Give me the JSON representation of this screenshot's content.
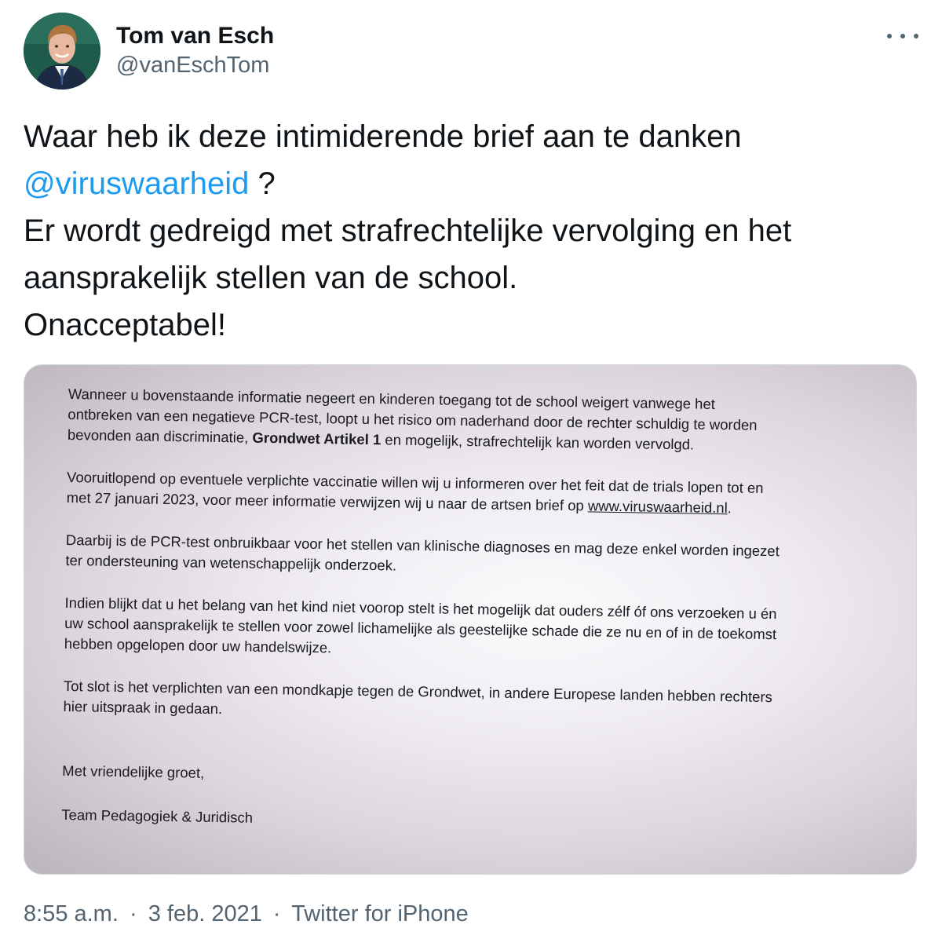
{
  "author": {
    "display_name": "Tom van Esch",
    "handle": "@vanEschTom",
    "avatar_icon": "profile-photo"
  },
  "tweet": {
    "line1": "Waar heb ik deze intimiderende brief aan te danken",
    "mention": "@viruswaarheid",
    "after_mention": " ?",
    "line3": "Er wordt gedreigd met strafrechtelijke vervolging en het",
    "line4": "aansprakelijk stellen van de school.",
    "line5": "Onacceptabel!"
  },
  "letter": {
    "p1_l1": "Wanneer u bovenstaande informatie negeert en kinderen toegang tot de school weigert vanwege het",
    "p1_l2": "ontbreken van een negatieve PCR-test, loopt u het risico om naderhand door de rechter schuldig te worden",
    "p1_l3_a": "bevonden aan discriminatie, ",
    "p1_l3_bold": "Grondwet Artikel 1",
    "p1_l3_b": " en mogelijk, strafrechtelijk kan worden vervolgd.",
    "p2_l1": "Vooruitlopend op eventuele verplichte vaccinatie willen wij u informeren over het feit dat de trials lopen tot en",
    "p2_l2_a": "met 27 januari 2023, voor meer informatie verwijzen wij u naar de artsen brief op ",
    "p2_link": "www.viruswaarheid.nl",
    "p2_l2_b": ".",
    "p3_l1": "Daarbij is de PCR-test onbruikbaar voor het stellen van klinische diagnoses en mag deze enkel worden ingezet",
    "p3_l2": "ter ondersteuning van wetenschappelijk onderzoek.",
    "p4_l1": "Indien blijkt dat u het belang van het kind niet voorop stelt is het mogelijk dat ouders zélf óf ons verzoeken u én",
    "p4_l2": "uw school aansprakelijk te stellen voor zowel lichamelijke als geestelijke schade die ze nu en of in de toekomst",
    "p4_l3": "hebben opgelopen door uw handelswijze.",
    "p5_l1": "Tot slot is het verplichten van een mondkapje tegen de Grondwet, in andere Europese landen hebben rechters",
    "p5_l2": "hier uitspraak in gedaan.",
    "closing": "Met vriendelijke groet,",
    "signature": "Team Pedagogiek & Juridisch"
  },
  "footer": {
    "time": "8:55 a.m.",
    "sep": "·",
    "date": "3 feb. 2021",
    "source": "Twitter for iPhone"
  }
}
